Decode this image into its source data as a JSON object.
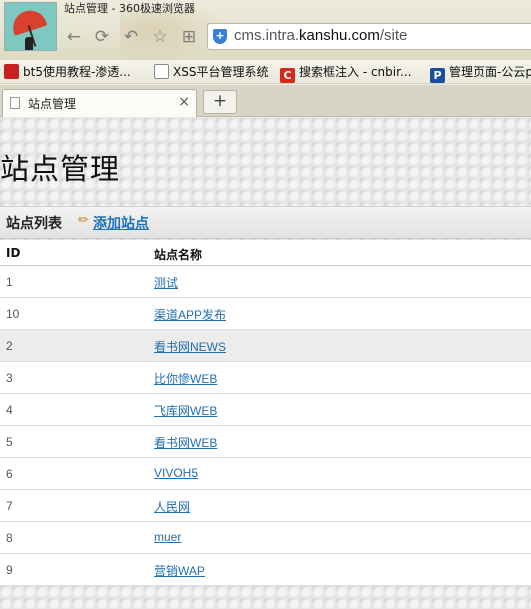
{
  "browser": {
    "window_title": "站点管理 - 360极速浏览器",
    "address_url_prefix": "cms.intra.",
    "address_url_domain": "kanshu.com",
    "address_url_path": "/site",
    "bookmarks": [
      {
        "label": "bt5使用教程-渗透...",
        "icon_color": "#c8201c"
      },
      {
        "label": "XSS平台管理系统",
        "icon_color": "#ffffff"
      },
      {
        "label": "搜索框注入 - cnbir...",
        "icon_color": "#d42a1d"
      },
      {
        "label": "管理页面-公云p",
        "icon_color": "#1a4f9c"
      }
    ],
    "tab": {
      "label": "站点管理",
      "close": "×"
    },
    "new_tab": "+"
  },
  "page": {
    "title": "站点管理",
    "list_label": "站点列表",
    "add_link": "添加站点",
    "columns": {
      "id": "ID",
      "name": "站点名称"
    },
    "rows": [
      {
        "id": "1",
        "name": "测试"
      },
      {
        "id": "10",
        "name": "渠道APP发布"
      },
      {
        "id": "2",
        "name": "看书网NEWS"
      },
      {
        "id": "3",
        "name": "比你慘WEB"
      },
      {
        "id": "4",
        "name": "飞库网WEB"
      },
      {
        "id": "5",
        "name": "看书网WEB"
      },
      {
        "id": "6",
        "name": "VIVOH5"
      },
      {
        "id": "7",
        "name": "人民网"
      },
      {
        "id": "8",
        "name": "muer"
      },
      {
        "id": "9",
        "name": "营销WAP"
      }
    ],
    "highlighted_row": 2,
    "link_color": "#1f6fb2"
  }
}
